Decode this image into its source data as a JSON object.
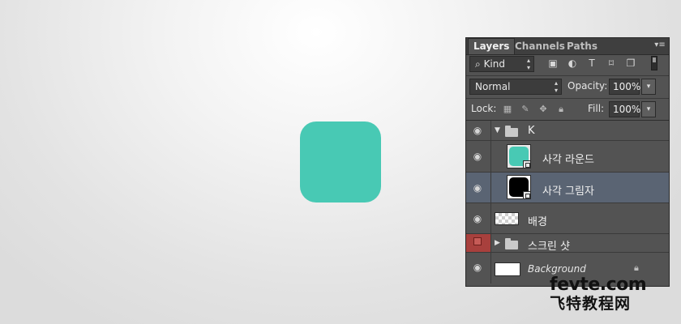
{
  "canvas": {
    "shape_color": "#48c9b4"
  },
  "panel": {
    "tabs": [
      "Layers",
      "Channels",
      "Paths"
    ],
    "menu_icon": "panel-menu-icon",
    "filter": {
      "search_icon": "⌕",
      "kind_label": "Kind"
    },
    "blend_mode": "Normal",
    "opacity_label": "Opacity:",
    "opacity_value": "100%",
    "lock_label": "Lock:",
    "fill_label": "Fill:",
    "fill_value": "100%",
    "layers": [
      {
        "name": "K",
        "type": "group",
        "expanded": true,
        "visible": true
      },
      {
        "name": "사각 라운드",
        "type": "shape",
        "color": "#48c9b4",
        "visible": true
      },
      {
        "name": "사각 그림자",
        "type": "shape",
        "color": "#000000",
        "visible": true,
        "selected": true
      },
      {
        "name": "배경",
        "type": "pixel",
        "visible": true
      },
      {
        "name": "스크린 샷",
        "type": "group",
        "expanded": false,
        "visible": false,
        "label_color": "#a8403d"
      },
      {
        "name": "Background",
        "type": "background",
        "visible": true,
        "locked": true
      }
    ]
  },
  "watermark": {
    "line1": "fevte.com",
    "line2": "飞特教程网"
  }
}
